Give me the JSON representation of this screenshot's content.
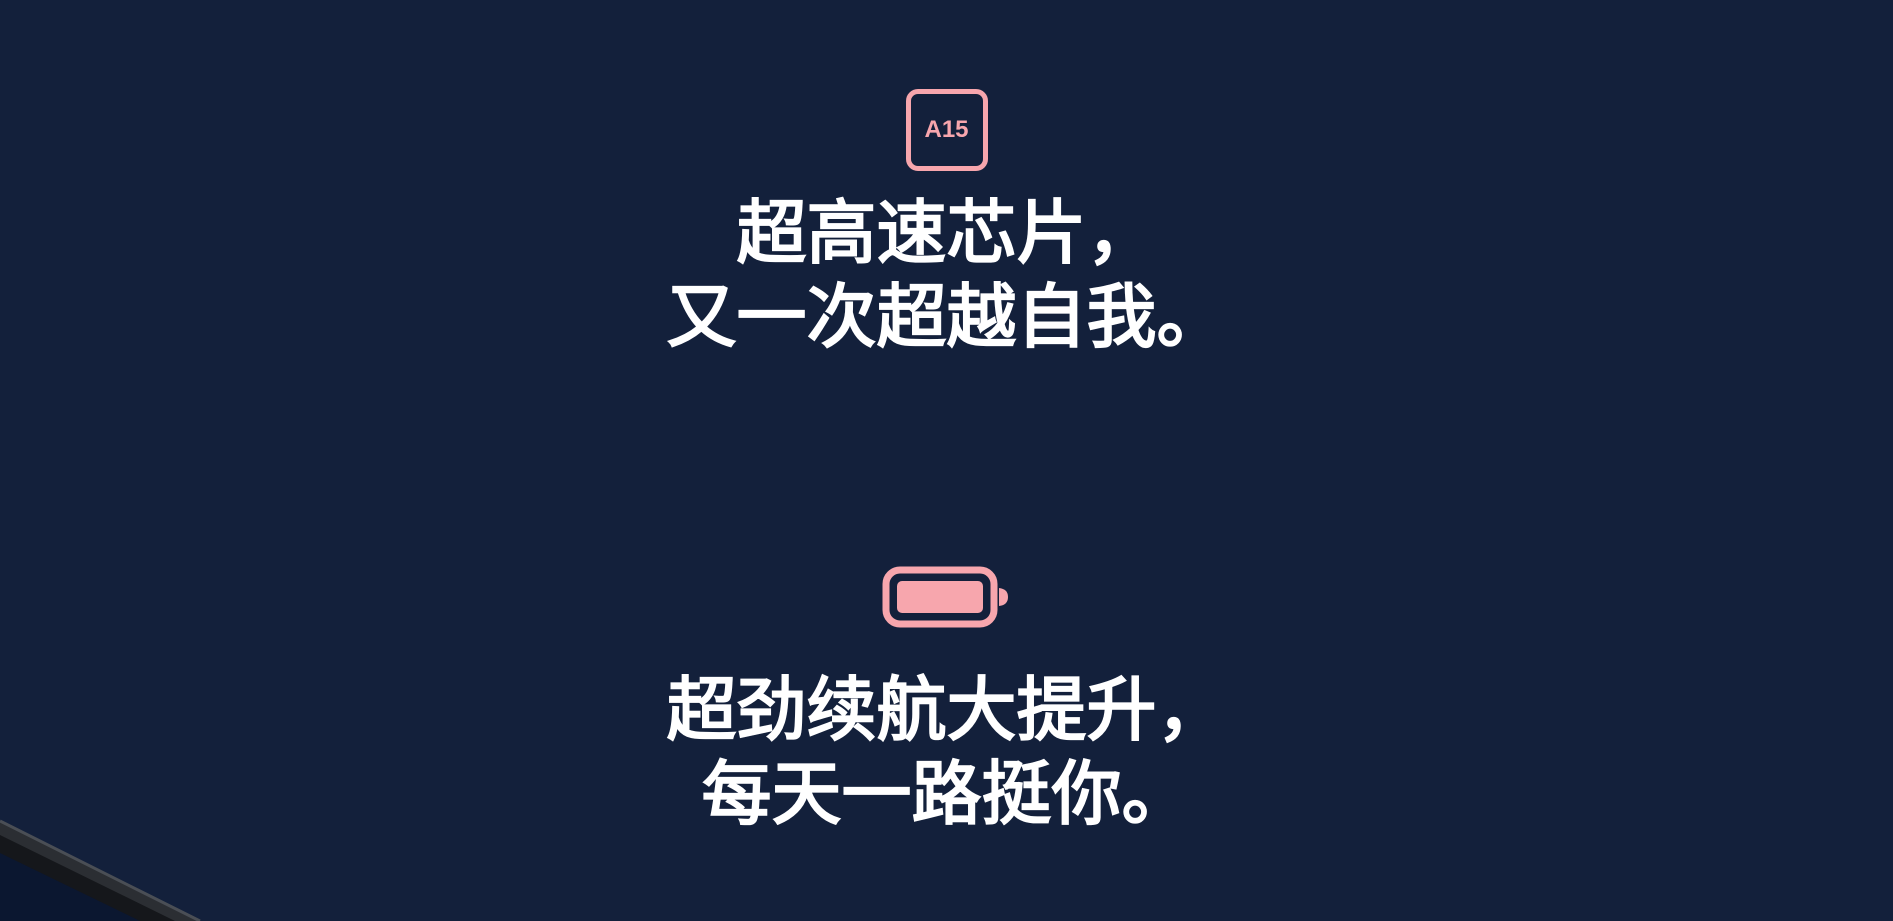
{
  "chip_feature": {
    "icon_label": "A15",
    "icon_name": "chip-icon",
    "line1": "超高速芯片，",
    "line2": "又一次超越自我。"
  },
  "battery_feature": {
    "icon_name": "battery-icon",
    "line1": "超劲续航大提升，",
    "line2": "每天一路挺你。"
  },
  "colors": {
    "background": "#13203b",
    "accent": "#f7a6ad",
    "text": "#ffffff"
  }
}
